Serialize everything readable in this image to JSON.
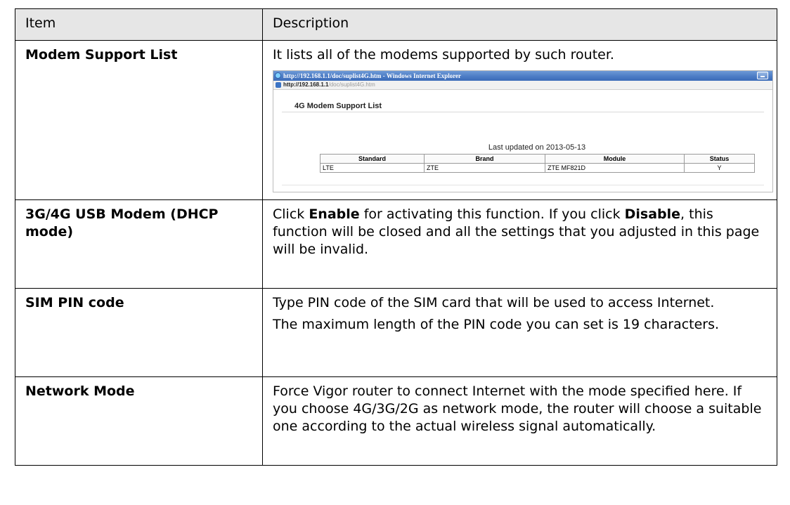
{
  "table": {
    "header": {
      "item": "Item",
      "description": "Description"
    },
    "rows": [
      {
        "item": "Modem Support List",
        "description": "It lists all of the modems supported by such router."
      },
      {
        "item": "3G/4G USB Modem (DHCP mode)",
        "description_parts": [
          "Click ",
          "Enable",
          " for activating this function. If you click ",
          "Disable",
          ", this function will be closed and all the settings that you adjusted in this page will be invalid."
        ]
      },
      {
        "item": "SIM PIN code",
        "description_paragraphs": [
          "Type PIN code of the SIM card that will be used to access Internet.",
          "The maximum length of the PIN code you can set is 19 characters."
        ]
      },
      {
        "item": "Network Mode",
        "description": "Force Vigor router to connect Internet with the mode specified here. If you choose 4G/3G/2G as network mode, the router will choose a suitable one according to the actual wireless signal automatically."
      }
    ]
  },
  "screenshot": {
    "window_title": "http://192.168.1.1/doc/suplist4G.htm - Windows Internet Explorer",
    "address_host": "http://192.168.1.1",
    "address_path": "/doc/suplist4G.htm",
    "page_title": "4G Modem Support List",
    "updated_text": "Last updated on 2013-05-13",
    "columns": [
      "Standard",
      "Brand",
      "Module",
      "Status"
    ],
    "rows": [
      [
        "LTE",
        "ZTE",
        "ZTE MF821D",
        "Y"
      ]
    ],
    "icons": {
      "browser": "ie-icon",
      "minimize": "minimize-icon",
      "page": "page-icon"
    }
  }
}
